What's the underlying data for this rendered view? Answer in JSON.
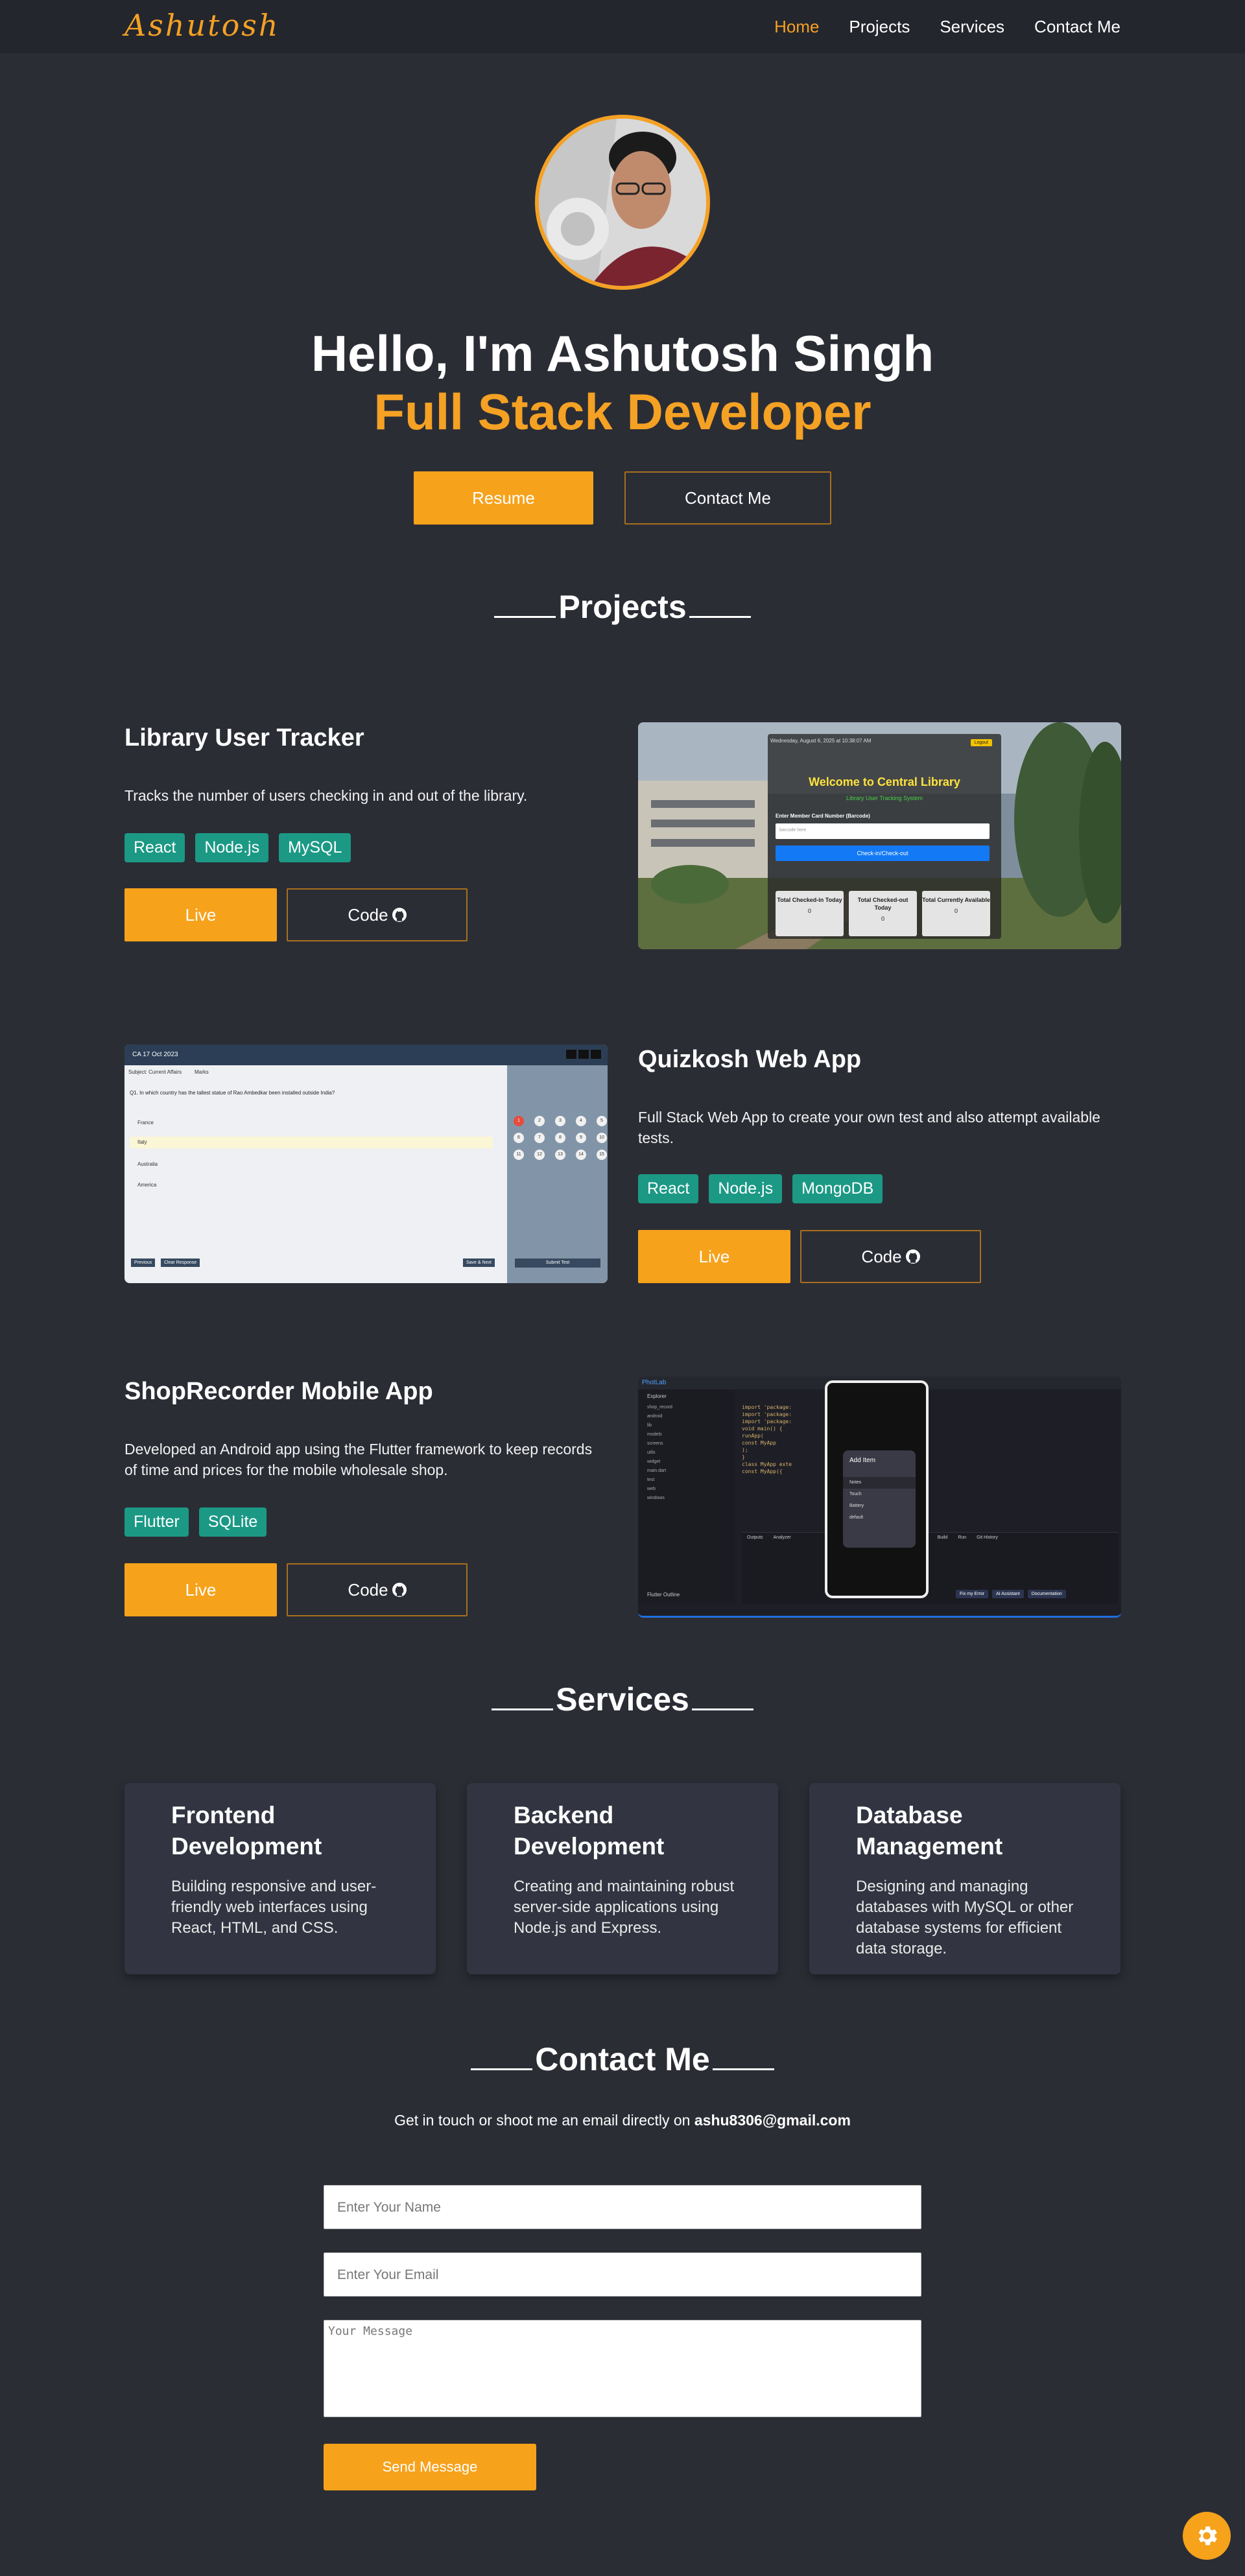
{
  "nav": {
    "logo": "Ashutosh",
    "links": [
      "Home",
      "Projects",
      "Services",
      "Contact Me"
    ]
  },
  "hero": {
    "title": "Hello, I'm Ashutosh Singh",
    "subtitle": "Full Stack Developer",
    "resume_label": "Resume",
    "contact_label": "Contact Me"
  },
  "projects": {
    "heading": "Projects",
    "items": [
      {
        "title": "Library User Tracker",
        "description": "Tracks the number of users checking in and out of the library.",
        "tags": [
          "React",
          "Node.js",
          "MySQL"
        ],
        "live_label": "Live",
        "code_label": "Code",
        "screenshot": {
          "date": "Wednesday, August 6, 2025 at 10:38:07 AM",
          "logout": "Logout",
          "welcome": "Welcome to Central Library",
          "subtitle": "Library User Tracking System",
          "field_label": "Enter Member Card Number (Barcode)",
          "field_placeholder": "barcode here",
          "button": "Check-in/Check-out",
          "stats": [
            {
              "label": "Total Checked-in Today",
              "value": "0"
            },
            {
              "label": "Total Checked-out Today",
              "value": "0"
            },
            {
              "label": "Total Currently Available",
              "value": "0"
            }
          ]
        }
      },
      {
        "title": "Quizkosh Web App",
        "description": "Full Stack Web App to create your own test and also attempt available tests.",
        "tags": [
          "React",
          "Node.js",
          "MongoDB"
        ],
        "live_label": "Live",
        "code_label": "Code",
        "screenshot": {
          "header": "CA 17 Oct 2023",
          "subject": "Subject: Current Affairs",
          "marks": "Marks",
          "question": "Q1. In which country has the tallest statue of Rao Ambedkar been installed outside India?",
          "options": [
            "France",
            "Italy",
            "Australia",
            "America"
          ],
          "prev": "Previous",
          "clear": "Clear Response",
          "save": "Save & Next",
          "submit": "Submit Test",
          "numbers": [
            "1",
            "2",
            "3",
            "4",
            "5",
            "6",
            "7",
            "8",
            "9",
            "10",
            "11",
            "12",
            "13",
            "14",
            "15"
          ]
        }
      },
      {
        "title": "ShopRecorder Mobile App",
        "description": "Developed an Android app using the Flutter framework to keep records of time and prices for the mobile wholesale shop.",
        "tags": [
          "Flutter",
          "SQLite"
        ],
        "live_label": "Live",
        "code_label": "Code",
        "screenshot": {
          "ide": "PhotLab",
          "explorer": "Explorer",
          "tree": [
            "shop_record",
            "android",
            "lib",
            "models",
            "screens",
            "utils",
            "widget",
            "main.dart",
            "test",
            "web",
            "windows"
          ],
          "code": [
            "import 'package:",
            "import 'package:",
            "import 'package:",
            "",
            "void main() {",
            "  runApp(",
            "    const MyApp",
            "  );",
            "}",
            "",
            "class MyApp exte",
            "  const MyApp({"
          ],
          "add_item": "Add Item",
          "menu": [
            "Notes",
            "Touch",
            "Battery",
            "default"
          ],
          "tabs": [
            "Outputs",
            "Analyzer",
            "Build",
            "Run",
            "Git History"
          ],
          "actions": [
            "Fix my Error",
            "AI Assistant",
            "Documentation"
          ],
          "flutter_outline": "Flutter Outline"
        }
      }
    ]
  },
  "services": {
    "heading": "Services",
    "items": [
      {
        "title": "Frontend Development",
        "description": "Building responsive and user-friendly web interfaces using React, HTML, and CSS."
      },
      {
        "title": "Backend Development",
        "description": "Creating and maintaining robust server-side applications using Node.js and Express."
      },
      {
        "title": "Database Management",
        "description": "Designing and managing databases with MySQL or other database systems for efficient data storage."
      }
    ]
  },
  "contact": {
    "heading": "Contact Me",
    "note": "Get in touch or shoot me an email directly on",
    "email": "ashu8306@gmail.com",
    "name_placeholder": "Enter Your Name",
    "email_placeholder": "Enter Your Email",
    "message_placeholder": "Your Message",
    "send_label": "Send Message"
  },
  "colors": {
    "accent": "#f6a21b",
    "background": "#2b2d35",
    "tag": "#1b9985"
  }
}
